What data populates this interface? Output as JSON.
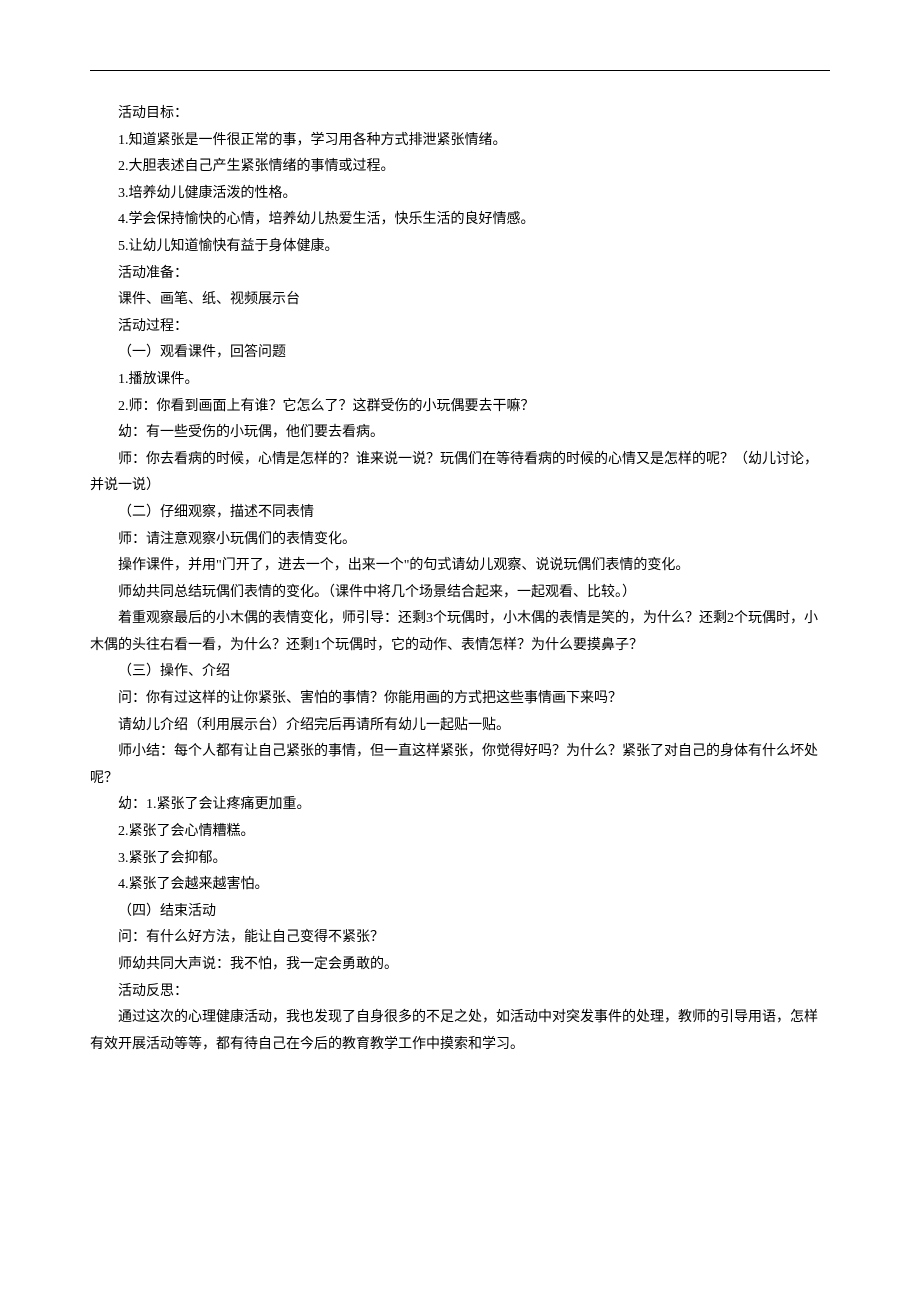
{
  "lines": [
    "活动目标：",
    "1.知道紧张是一件很正常的事，学习用各种方式排泄紧张情绪。",
    "2.大胆表述自己产生紧张情绪的事情或过程。",
    "3.培养幼儿健康活泼的性格。",
    "4.学会保持愉快的心情，培养幼儿热爱生活，快乐生活的良好情感。",
    "5.让幼儿知道愉快有益于身体健康。",
    "活动准备：",
    "课件、画笔、纸、视频展示台",
    "活动过程：",
    "（一）观看课件，回答问题",
    "1.播放课件。",
    "2.师：你看到画面上有谁？它怎么了？这群受伤的小玩偶要去干嘛？",
    "幼：有一些受伤的小玩偶，他们要去看病。",
    "师：你去看病的时候，心情是怎样的？谁来说一说？玩偶们在等待看病的时候的心情又是怎样的呢？（幼儿讨论，"
  ],
  "noindent1": "并说一说）",
  "lines2": [
    "（二）仔细观察，描述不同表情",
    "师：请注意观察小玩偶们的表情变化。",
    "操作课件，并用\"门开了，进去一个，出来一个\"的句式请幼儿观察、说说玩偶们表情的变化。",
    "师幼共同总结玩偶们表情的变化。（课件中将几个场景结合起来，一起观看、比较。）",
    "着重观察最后的小木偶的表情变化，师引导：还剩3个玩偶时，小木偶的表情是笑的，为什么？还剩2个玩偶时，小"
  ],
  "noindent2": "木偶的头往右看一看，为什么？还剩1个玩偶时，它的动作、表情怎样？为什么要摸鼻子？",
  "lines3": [
    "（三）操作、介绍",
    "问：你有过这样的让你紧张、害怕的事情？你能用画的方式把这些事情画下来吗？",
    "请幼儿介绍（利用展示台）介绍完后再请所有幼儿一起贴一贴。",
    "师小结：每个人都有让自己紧张的事情，但一直这样紧张，你觉得好吗？为什么？紧张了对自己的身体有什么坏处"
  ],
  "noindent3": "呢？",
  "lines4": [
    "幼：1.紧张了会让疼痛更加重。",
    "2.紧张了会心情糟糕。",
    "3.紧张了会抑郁。",
    "4.紧张了会越来越害怕。",
    "（四）结束活动",
    "问：有什么好方法，能让自己变得不紧张？",
    "师幼共同大声说：我不怕，我一定会勇敢的。",
    "活动反思：",
    "通过这次的心理健康活动，我也发现了自身很多的不足之处，如活动中对突发事件的处理，教师的引导用语，怎样"
  ],
  "noindent4": "有效开展活动等等，都有待自己在今后的教育教学工作中摸索和学习。"
}
